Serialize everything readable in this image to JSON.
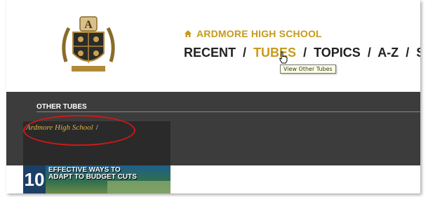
{
  "header": {
    "school_name": "ARDMORE HIGH SCHOOL",
    "home_icon": "home-icon",
    "logo": "school-crest",
    "logo_letter": "A"
  },
  "nav": {
    "items": [
      "RECENT",
      "TUBES",
      "TOPICS",
      "A-Z",
      "SE"
    ],
    "separator": "/",
    "active": "TUBES"
  },
  "tooltip": {
    "text": "View Other Tubes"
  },
  "section": {
    "title": "OTHER TUBES",
    "breadcrumb": "Ardmore High School",
    "breadcrumb_sep": "/"
  },
  "thumbnail": {
    "number": "10",
    "line1": "EFFECTIVE WAYS TO",
    "line2": "ADAPT TO BUDGET CUTS"
  },
  "colors": {
    "accent": "#c69a1a",
    "dark_band": "#3c3c3c",
    "highlight_ellipse": "#d01818"
  }
}
